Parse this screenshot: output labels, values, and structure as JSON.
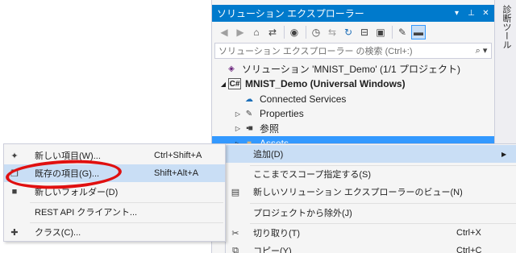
{
  "solution_explorer": {
    "title": "ソリューション エクスプローラー",
    "title_buttons": [
      "▾",
      "⊥",
      "✕"
    ],
    "search_placeholder": "ソリューション エクスプローラー の検索 (Ctrl+:)",
    "tree": {
      "solution": "ソリューション 'MNIST_Demo' (1/1 プロジェクト)",
      "project": "MNIST_Demo (Universal Windows)",
      "connected_services": "Connected Services",
      "properties": "Properties",
      "references": "参照",
      "assets": "Assets"
    }
  },
  "side_tab": {
    "label": "診断ツール"
  },
  "main_menu": {
    "items": [
      {
        "label": "追加(D)",
        "shortcut": ""
      },
      {
        "label": "ここまでスコープ指定する(S)",
        "shortcut": ""
      },
      {
        "label": "新しいソリューション エクスプローラーのビュー(N)",
        "shortcut": ""
      },
      {
        "label": "プロジェクトから除外(J)",
        "shortcut": ""
      },
      {
        "label": "切り取り(T)",
        "shortcut": "Ctrl+X"
      },
      {
        "label": "コピー(Y)",
        "shortcut": "Ctrl+C"
      }
    ]
  },
  "sub_menu": {
    "items": [
      {
        "label": "新しい項目(W)...",
        "shortcut": "Ctrl+Shift+A"
      },
      {
        "label": "既存の項目(G)...",
        "shortcut": "Shift+Alt+A"
      },
      {
        "label": "新しいフォルダー(D)",
        "shortcut": ""
      },
      {
        "label": "REST API クライアント...",
        "shortcut": ""
      },
      {
        "label": "クラス(C)...",
        "shortcut": ""
      }
    ]
  },
  "colors": {
    "accent": "#007acc",
    "selection": "#3399ff",
    "menu_highlight": "#c9def5",
    "annotation_circle": "#e01010"
  }
}
